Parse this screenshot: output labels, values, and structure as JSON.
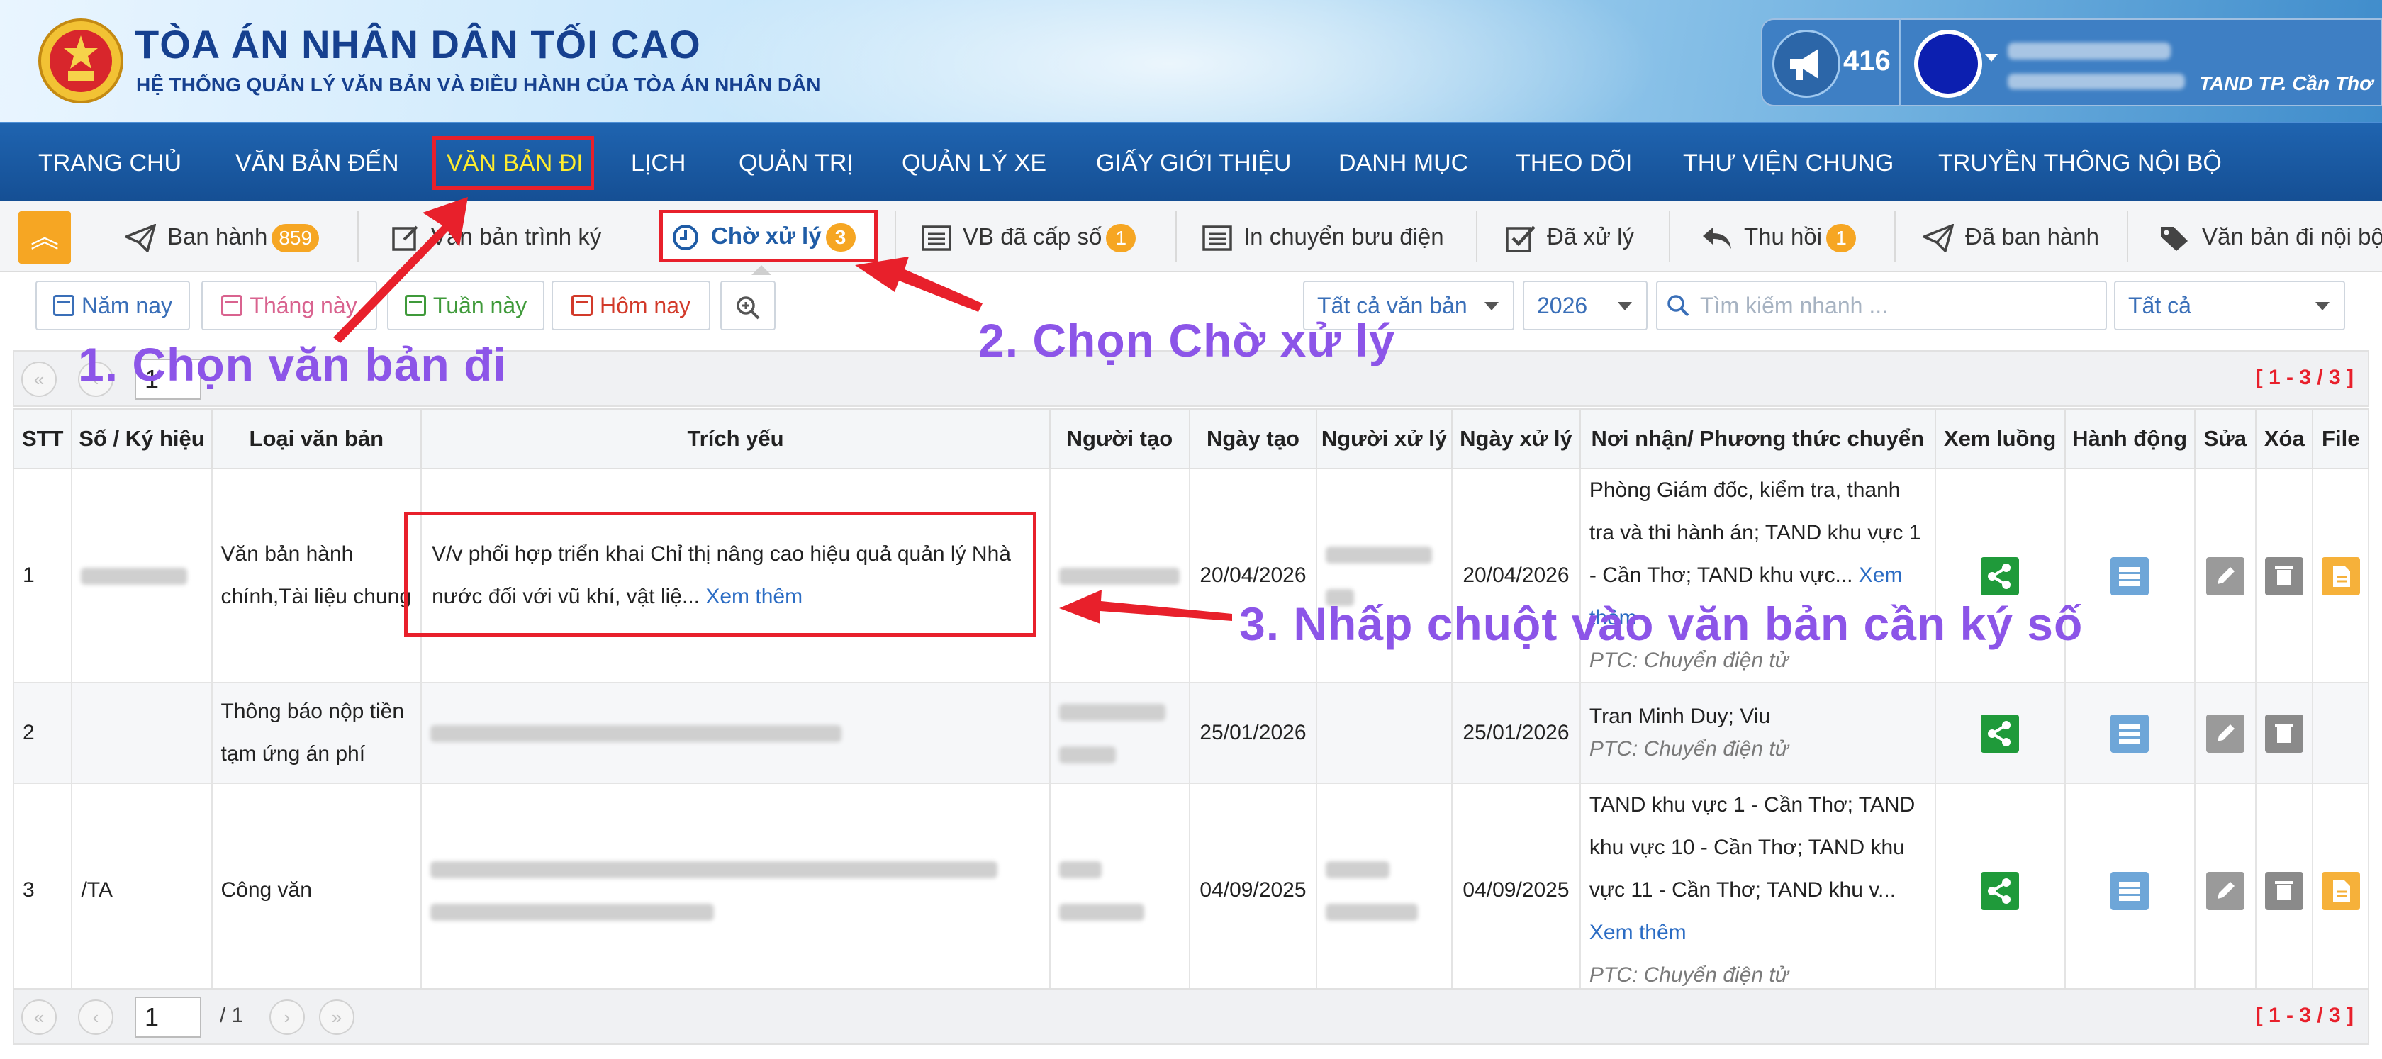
{
  "header": {
    "title": "TÒA ÁN NHÂN DÂN TỐI CAO",
    "subtitle": "HỆ THỐNG QUẢN LÝ VĂN BẢN VÀ ĐIỀU HÀNH CỦA TÒA ÁN NHÂN DÂN",
    "notification_count": "416",
    "user_org": "TAND TP. Cần Thơ"
  },
  "main_nav": {
    "items": [
      "TRANG CHỦ",
      "VĂN BẢN ĐẾN",
      "VĂN BẢN ĐI",
      "LỊCH",
      "QUẢN TRỊ",
      "QUẢN LÝ XE",
      "GIẤY GIỚI THIỆU",
      "DANH MỤC",
      "THEO DÕI",
      "THƯ VIỆN CHUNG",
      "TRUYỀN THÔNG NỘI BỘ"
    ],
    "active": "VĂN BẢN ĐI"
  },
  "sub_nav": {
    "items": [
      {
        "label": "Ban hành",
        "badge": "859",
        "icon": "send-icon"
      },
      {
        "label": "Văn bản trình ký",
        "badge": "",
        "icon": "edit-icon"
      },
      {
        "label": "Chờ xử lý",
        "badge": "3",
        "icon": "clock-icon"
      },
      {
        "label": "VB đã cấp số",
        "badge": "1",
        "icon": "list-icon"
      },
      {
        "label": "In chuyển bưu điện",
        "badge": "",
        "icon": "list-icon"
      },
      {
        "label": "Đã xử lý",
        "badge": "",
        "icon": "check-icon"
      },
      {
        "label": "Thu hồi",
        "badge": "1",
        "icon": "reply-icon"
      },
      {
        "label": "Đã ban hành",
        "badge": "",
        "icon": "send-icon"
      },
      {
        "label": "Văn bản đi nội bộ",
        "badge": "",
        "icon": "tag-icon"
      }
    ],
    "active": "Chờ xử lý"
  },
  "filters": {
    "year_button": "Năm nay",
    "month_button": "Tháng này",
    "week_button": "Tuần này",
    "today_button": "Hôm nay",
    "doc_type_select": "Tất cả văn bản",
    "year_select": "2026",
    "search_placeholder": "Tìm kiếm nhanh ...",
    "status_select": "Tất cả"
  },
  "pager": {
    "page": "1",
    "total": "/ 1",
    "range": "[ 1 - 3 / 3 ]"
  },
  "table": {
    "columns": [
      "STT",
      "Số / Ký hiệu",
      "Loại văn bản",
      "Trích yếu",
      "Người tạo",
      "Ngày tạo",
      "Người xử lý",
      "Ngày xử lý",
      "Nơi nhận/ Phương thức chuyển",
      "Xem luồng",
      "Hành động",
      "Sửa",
      "Xóa",
      "File"
    ],
    "rows": [
      {
        "stt": "1",
        "so_ky_hieu": "",
        "loai": "Văn bản hành chính,Tài liệu chung",
        "trich_yeu": "V/v phối hợp triển khai Chỉ thị nâng cao hiệu quả quản lý Nhà nước đối với vũ khí, vật liệ...",
        "xem_them": "Xem thêm",
        "ngay_tao": "20/04/2026",
        "ngay_xu_ly": "20/04/2026",
        "noi_nhan": "Phòng Giám đốc, kiểm tra, thanh tra và thi hành án; TAND khu vực 1 - Cần Thơ; TAND khu vực...",
        "noi_nhan_more": "Xem thêm",
        "ptc": "PTC: Chuyển điện tử",
        "has_file": true
      },
      {
        "stt": "2",
        "so_ky_hieu": "",
        "loai": "Thông báo nộp tiền tạm ứng án phí",
        "trich_yeu": "",
        "xem_them": "",
        "ngay_tao": "25/01/2026",
        "ngay_xu_ly": "25/01/2026",
        "noi_nhan": "Tran Minh Duy; Viu",
        "noi_nhan_more": "",
        "ptc": "PTC: Chuyển điện tử",
        "has_file": false
      },
      {
        "stt": "3",
        "so_ky_hieu": "/TA",
        "loai": "Công văn",
        "trich_yeu": "",
        "xem_them": "",
        "ngay_tao": "04/09/2025",
        "ngay_xu_ly": "04/09/2025",
        "noi_nhan": "TAND khu vực 1 - Cần Thơ; TAND khu vực 10 - Cần Thơ; TAND khu vực 11 - Cần Thơ; TAND khu v...",
        "noi_nhan_more": "Xem thêm",
        "ptc": "PTC: Chuyển điện tử",
        "has_file": true
      }
    ]
  },
  "annotations": {
    "step1": "1. Chọn văn bản đi",
    "step2": "2. Chọn Chờ xử lý",
    "step3": "3. Nhấp chuột vào văn bản cần ký số"
  },
  "colors": {
    "nav_bg": "#1b5aa3",
    "accent_orange": "#f6a623",
    "annotation_purple": "#8c55e8",
    "highlight_red": "#e8202b"
  }
}
